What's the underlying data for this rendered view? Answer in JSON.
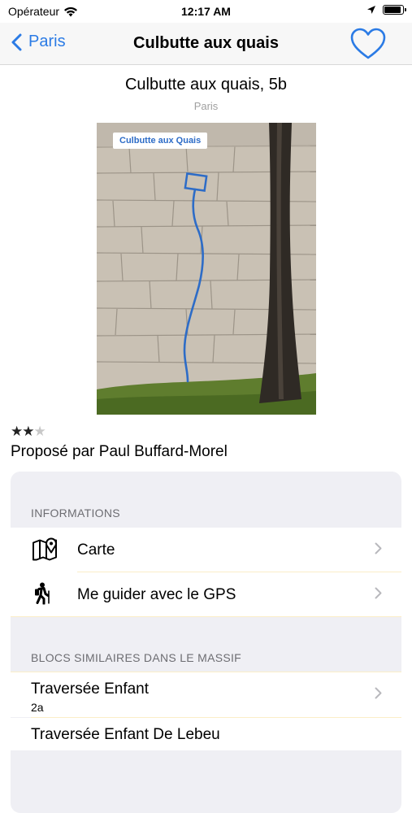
{
  "status_bar": {
    "carrier": "Opérateur",
    "time": "12:17 AM",
    "battery_level": 0.9
  },
  "nav": {
    "back_label": "Paris",
    "title": "Culbutte aux quais"
  },
  "problem": {
    "title": "Culbutte aux quais, 5b",
    "area": "Paris",
    "photo_label": "Culbutte aux Quais",
    "rating_filled": "★★",
    "rating_empty": "★",
    "rating_value": 2,
    "rating_max": 3,
    "proposed_by": "Proposé par Paul Buffard-Morel"
  },
  "sections": {
    "informations": {
      "header": "INFORMATIONS",
      "items": [
        {
          "label": "Carte",
          "icon": "map-icon"
        },
        {
          "label": "Me guider avec le GPS",
          "icon": "hiker-icon"
        }
      ]
    },
    "similar": {
      "header": "BLOCS SIMILAIRES DANS LE MASSIF",
      "items": [
        {
          "title": "Traversée Enfant",
          "grade": "2a"
        },
        {
          "title": "Traversée Enfant De Lebeu"
        }
      ]
    }
  },
  "colors": {
    "accent": "#2b7be5",
    "line": "#2d6cc7",
    "group_bg": "#efeff4",
    "separator": "#fbeec8"
  }
}
